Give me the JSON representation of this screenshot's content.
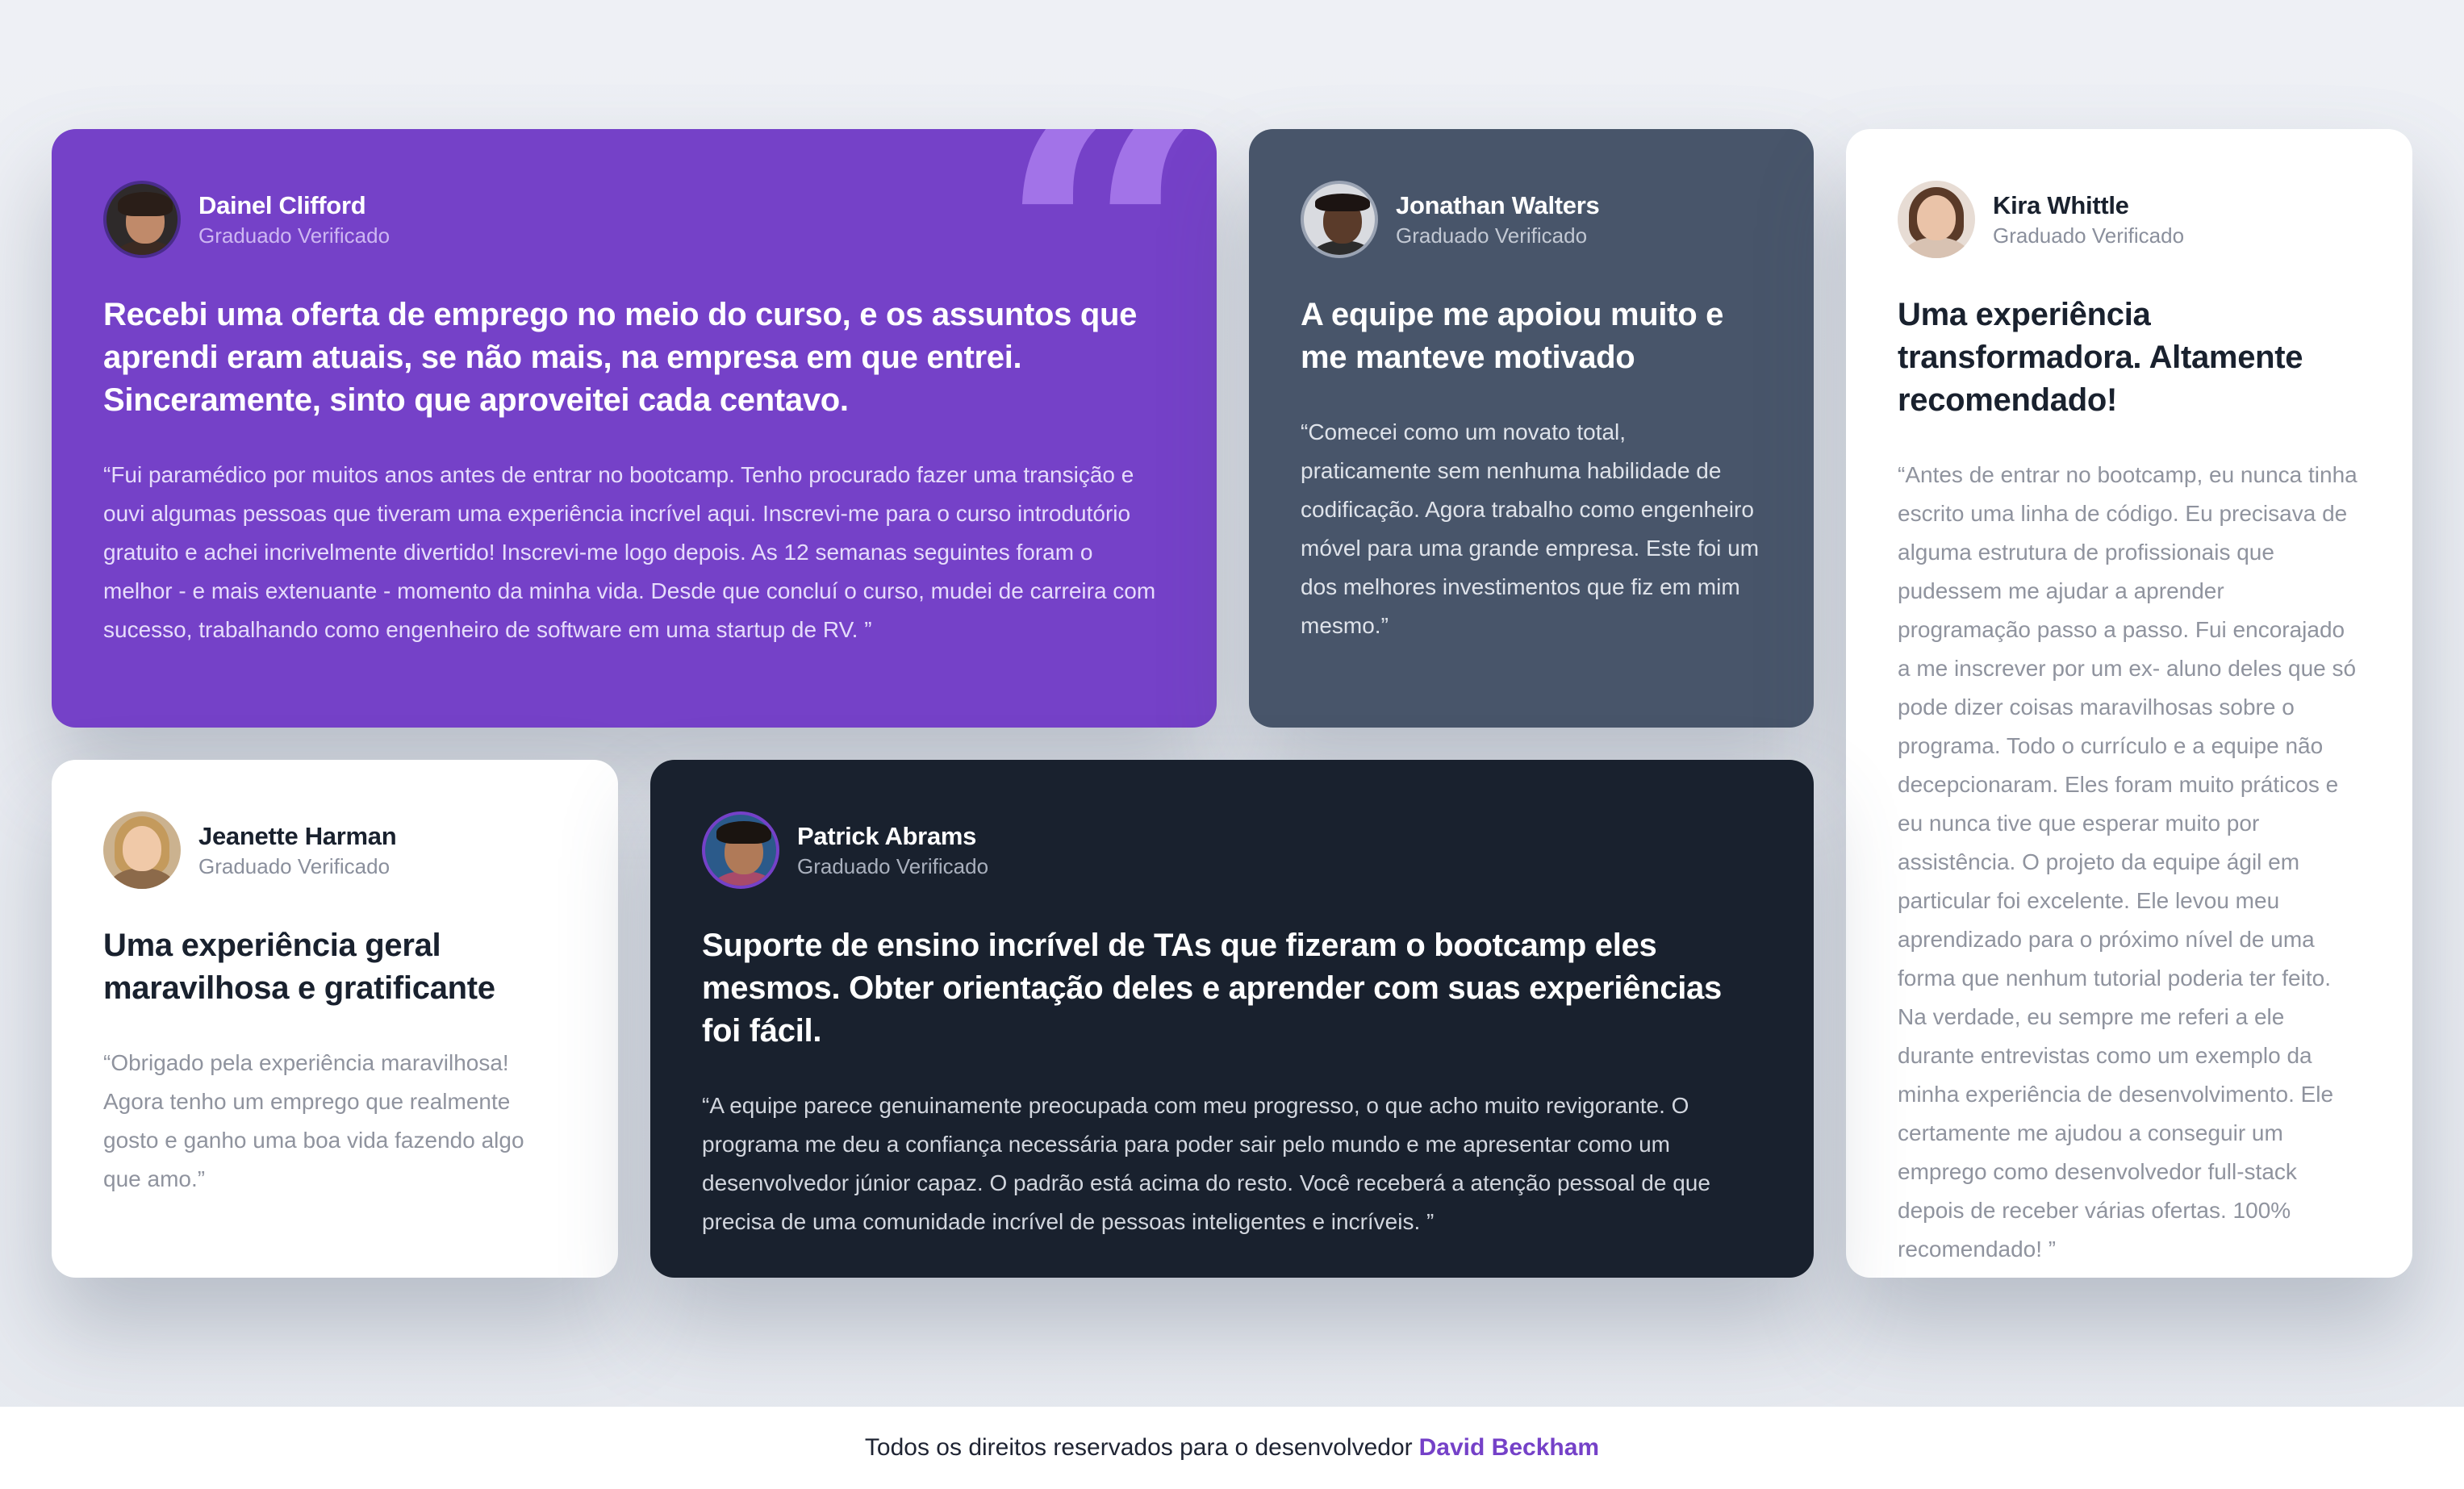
{
  "colors": {
    "purple": "#7541c8",
    "gray_blue": "#48556a",
    "dark": "#19212e",
    "white": "#ffffff",
    "accent_quote": "#a577ea"
  },
  "testimonials": [
    {
      "name": "Dainel Clifford",
      "role": "Graduado Verificado",
      "headline": "Recebi uma oferta de emprego no meio do curso, e os assuntos que aprendi eram atuais, se não mais, na empresa em que entrei. Sinceramente, sinto que aproveitei cada centavo.",
      "quote": "“Fui paramédico por muitos anos antes de entrar no bootcamp. Tenho procurado fazer uma transição e ouvi algumas pessoas que tiveram uma experiência incrível aqui. Inscrevi-me para o curso introdutório gratuito e achei incrivelmente divertido! Inscrevi-me logo depois. As 12 semanas seguintes foram o melhor - e mais extenuante - momento da minha vida. Desde que concluí o curso, mudei de carreira com sucesso, trabalhando como engenheiro de software em uma startup de RV. ”",
      "avatar_icon": "portrait-icon"
    },
    {
      "name": "Jonathan Walters",
      "role": "Graduado Verificado",
      "headline": "A equipe me apoiou muito e me manteve motivado",
      "quote": "“Comecei como um novato total, praticamente sem nenhuma habilidade de codificação. Agora trabalho como engenheiro móvel para uma grande empresa. Este foi um dos melhores investimentos que fiz em mim mesmo.”",
      "avatar_icon": "portrait-icon"
    },
    {
      "name": "Kira Whittle",
      "role": "Graduado Verificado",
      "headline": "Uma experiência transformadora. Altamente recomendado!",
      "quote": "“Antes de entrar no bootcamp, eu nunca tinha escrito uma linha de código. Eu precisava de alguma estrutura de profissionais que pudessem me ajudar a aprender programação passo a passo. Fui encorajado a me inscrever por um ex- aluno deles que só pode dizer coisas maravilhosas sobre o programa. Todo o currículo e a equipe não decepcionaram. Eles foram muito práticos e eu nunca tive que esperar muito por assistência. O projeto da equipe ágil em particular foi excelente. Ele levou meu aprendizado para o próximo nível de uma forma que nenhum tutorial poderia ter feito. Na verdade, eu sempre me referi a ele durante entrevistas como um exemplo da minha experiência de desenvolvimento. Ele certamente me ajudou a conseguir um emprego como desenvolvedor full-stack depois de receber várias ofertas. 100% recomendado! ”",
      "avatar_icon": "portrait-icon"
    },
    {
      "name": "Jeanette Harman",
      "role": "Graduado Verificado",
      "headline": "Uma experiência geral maravilhosa e gratificante",
      "quote": "“Obrigado pela experiência maravilhosa! Agora tenho um emprego que realmente gosto e ganho uma boa vida fazendo algo que amo.”",
      "avatar_icon": "portrait-icon"
    },
    {
      "name": "Patrick Abrams",
      "role": "Graduado Verificado",
      "headline": "Suporte de ensino incrível de TAs que fizeram o bootcamp eles mesmos. Obter orientação deles e aprender com suas experiências foi fácil.",
      "quote": "“A equipe parece genuinamente preocupada com meu progresso, o que acho muito revigorante. O programa me deu a confiança necessária para poder sair pelo mundo e me apresentar como um desenvolvedor júnior capaz. O padrão está acima do resto. Você receberá a atenção pessoal de que precisa de uma comunidade incrível de pessoas inteligentes e incríveis. ”",
      "avatar_icon": "portrait-icon"
    }
  ],
  "decor": {
    "quote_icon": "quote-mark-icon",
    "quote_glyph": "“"
  },
  "footer": {
    "text": "Todos os direitos reservados para o desenvolvedor",
    "author": "David Beckham"
  }
}
